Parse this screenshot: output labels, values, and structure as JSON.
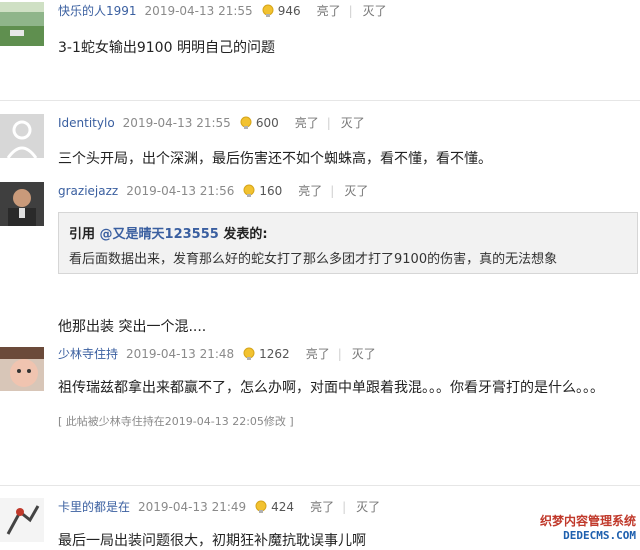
{
  "comments": [
    {
      "username": "快乐的人1991",
      "time": "2019-04-13 21:55",
      "likes": "946",
      "like_label": "亮了",
      "sep": "|",
      "dislike_label": "灭了",
      "text": "3-1蛇女输出9100 明明自己的问题"
    },
    {
      "username": "Identitylo",
      "time": "2019-04-13 21:55",
      "likes": "600",
      "like_label": "亮了",
      "sep": "|",
      "dislike_label": "灭了",
      "text": "三个头开局，出个深渊，最后伤害还不如个蜘蛛高，看不懂，看不懂。"
    },
    {
      "username": "graziejazz",
      "time": "2019-04-13 21:56",
      "likes": "160",
      "like_label": "亮了",
      "sep": "|",
      "dislike_label": "灭了",
      "quote": {
        "prefix": "引用 ",
        "user": "@又是晴天123555",
        "suffix": " 发表的:",
        "body": "看后面数据出来，发育那么好的蛇女打了那么多团才打了9100的伤害，真的无法想象"
      },
      "text": "他那出装 突出一个混...."
    },
    {
      "username": "少林寺住持",
      "time": "2019-04-13 21:48",
      "likes": "1262",
      "like_label": "亮了",
      "sep": "|",
      "dislike_label": "灭了",
      "text": "祖传瑞兹都拿出来都赢不了，怎么办啊，对面中单跟着我混。。。你看牙膏打的是什么。。。",
      "edit_note": "[ 此帖被少林寺住持在2019-04-13 22:05修改 ]"
    },
    {
      "username": "卡里的都是在",
      "time": "2019-04-13 21:49",
      "likes": "424",
      "like_label": "亮了",
      "sep": "|",
      "dislike_label": "灭了",
      "text": "最后一局出装问题很大，初期狂补魔抗耽误事儿啊"
    }
  ],
  "watermark": {
    "line1": "织梦内容管理系统",
    "line2": "DEDECMS.COM"
  },
  "icons": {
    "like": "lightbulb-icon",
    "avatar_default": "default-avatar-icon"
  },
  "colors": {
    "username": "#3a5fa0",
    "bulb": "#f2c230"
  }
}
